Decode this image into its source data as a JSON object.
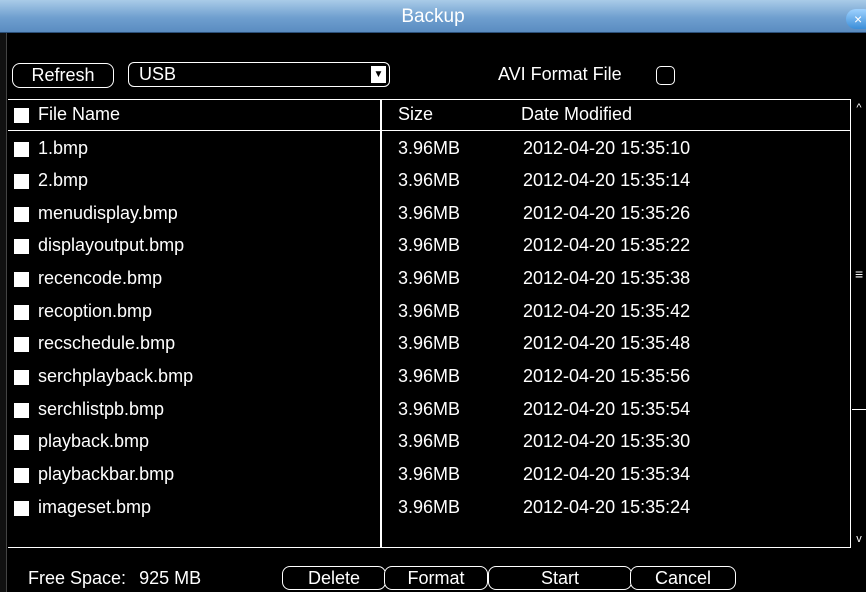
{
  "window": {
    "title": "Backup",
    "close_icon": "×"
  },
  "toolbar": {
    "refresh_label": "Refresh",
    "device_value": "USB",
    "dropdown_arrow": "▼",
    "avi_label": "AVI Format File",
    "avi_checked": false
  },
  "table": {
    "headers": {
      "name": "File Name",
      "size": "Size",
      "date": "Date Modified"
    },
    "rows": [
      {
        "name": "1.bmp",
        "size": "3.96MB",
        "date": "2012-04-20 15:35:10"
      },
      {
        "name": "2.bmp",
        "size": "3.96MB",
        "date": "2012-04-20 15:35:14"
      },
      {
        "name": "menudisplay.bmp",
        "size": "3.96MB",
        "date": "2012-04-20 15:35:26"
      },
      {
        "name": "displayoutput.bmp",
        "size": "3.96MB",
        "date": "2012-04-20 15:35:22"
      },
      {
        "name": "recencode.bmp",
        "size": "3.96MB",
        "date": "2012-04-20 15:35:38"
      },
      {
        "name": "recoption.bmp",
        "size": "3.96MB",
        "date": "2012-04-20 15:35:42"
      },
      {
        "name": "recschedule.bmp",
        "size": "3.96MB",
        "date": "2012-04-20 15:35:48"
      },
      {
        "name": "serchplayback.bmp",
        "size": "3.96MB",
        "date": "2012-04-20 15:35:56"
      },
      {
        "name": "serchlistpb.bmp",
        "size": "3.96MB",
        "date": "2012-04-20 15:35:54"
      },
      {
        "name": "playback.bmp",
        "size": "3.96MB",
        "date": "2012-04-20 15:35:30"
      },
      {
        "name": "playbackbar.bmp",
        "size": "3.96MB",
        "date": "2012-04-20 15:35:34"
      },
      {
        "name": "imageset.bmp",
        "size": "3.96MB",
        "date": "2012-04-20 15:35:24"
      }
    ]
  },
  "scrollbar": {
    "up_icon": "^",
    "down_icon": "v",
    "grip_icon": "≡"
  },
  "footer": {
    "free_space_label": "Free Space:",
    "free_space_value": "925 MB",
    "delete_label": "Delete",
    "format_label": "Format",
    "start_label": "Start",
    "cancel_label": "Cancel"
  }
}
